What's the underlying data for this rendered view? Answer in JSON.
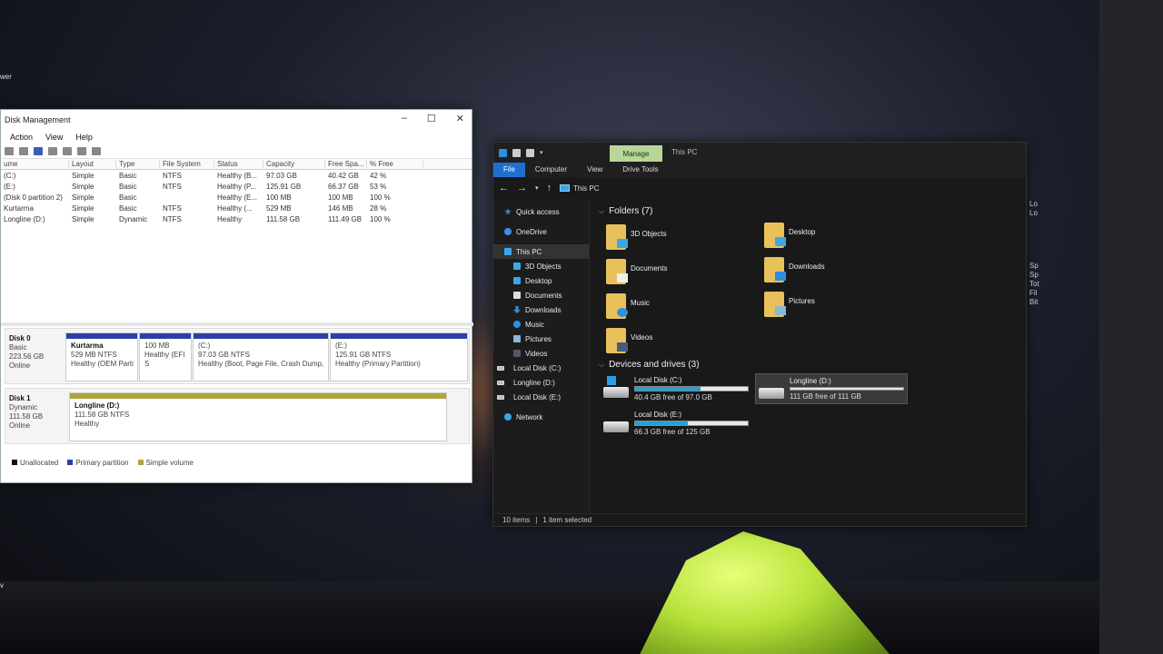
{
  "desktop": {
    "left_text_top": "wer",
    "left_text_bottom": "v"
  },
  "disk_mgmt": {
    "title": "Disk Management",
    "menu": [
      "Action",
      "View",
      "Help"
    ],
    "columns": [
      "ume",
      "Layout",
      "Type",
      "File System",
      "Status",
      "Capacity",
      "Free Spa...",
      "% Free"
    ],
    "rows": [
      [
        "(C:)",
        "Simple",
        "Basic",
        "NTFS",
        "Healthy (B...",
        "97.03 GB",
        "40.42 GB",
        "42 %"
      ],
      [
        "(E:)",
        "Simple",
        "Basic",
        "NTFS",
        "Healthy (P...",
        "125.91 GB",
        "66.37 GB",
        "53 %"
      ],
      [
        "(Disk 0 partition 2)",
        "Simple",
        "Basic",
        "",
        "Healthy (E...",
        "100 MB",
        "100 MB",
        "100 %"
      ],
      [
        "Kurtarma",
        "Simple",
        "Basic",
        "NTFS",
        "Healthy (...",
        "529 MB",
        "146 MB",
        "28 %"
      ],
      [
        "Longline (D:)",
        "Simple",
        "Dynamic",
        "NTFS",
        "Healthy",
        "111.58 GB",
        "111.49 GB",
        "100 %"
      ]
    ],
    "disk0": {
      "name": "Disk 0",
      "type": "Basic",
      "size": "223.56 GB",
      "status": "Online",
      "parts": [
        {
          "name": "Kurtarma",
          "size": "529 MB NTFS",
          "status": "Healthy (OEM Parti"
        },
        {
          "name": "",
          "size": "100 MB",
          "status": "Healthy (EFI S"
        },
        {
          "name": "(C:)",
          "size": "97.03 GB NTFS",
          "status": "Healthy (Boot, Page File, Crash Dump,"
        },
        {
          "name": "(E:)",
          "size": "125.91 GB NTFS",
          "status": "Healthy (Primary Partition)"
        }
      ]
    },
    "disk1": {
      "name": "Disk 1",
      "type": "Dynamic",
      "size": "111.58 GB",
      "status": "Online",
      "part": {
        "name": "Longline  (D:)",
        "size": "111.58 GB NTFS",
        "status": "Healthy"
      }
    },
    "legend": [
      {
        "label": "Unallocated",
        "color": "#111111"
      },
      {
        "label": "Primary partition",
        "color": "#2a3fa8"
      },
      {
        "label": "Simple volume",
        "color": "#b0a340"
      }
    ]
  },
  "explorer": {
    "manage_tab": "Manage",
    "title": "This PC",
    "ribbon": [
      "File",
      "Computer",
      "View",
      "Drive Tools"
    ],
    "address": "This PC",
    "nav": {
      "quick_access": "Quick access",
      "onedrive": "OneDrive",
      "this_pc": "This PC",
      "items": [
        "3D Objects",
        "Desktop",
        "Documents",
        "Downloads",
        "Music",
        "Pictures",
        "Videos",
        "Local Disk (C:)",
        "Longline (D:)",
        "Local Disk (E:)"
      ],
      "network": "Network"
    },
    "folders_header": "Folders (7)",
    "folders": [
      "3D Objects",
      "Desktop",
      "Documents",
      "Downloads",
      "Music",
      "Pictures",
      "Videos"
    ],
    "drives_header": "Devices and drives (3)",
    "drives": [
      {
        "name": "Local Disk (C:)",
        "free": "40.4 GB free of 97.0 GB",
        "used_fraction": 0.58
      },
      {
        "name": "Longline (D:)",
        "free": "111 GB free of 111 GB",
        "used_fraction": 0.0
      },
      {
        "name": "Local Disk (E:)",
        "free": "66.3 GB free of 125 GB",
        "used_fraction": 0.47
      }
    ],
    "status_items": "10 items",
    "status_selected": "1 item selected"
  },
  "right_edge": [
    "Lo",
    "Lo",
    "Sp",
    "Sp",
    "Tot",
    "Fil",
    "Bit"
  ]
}
